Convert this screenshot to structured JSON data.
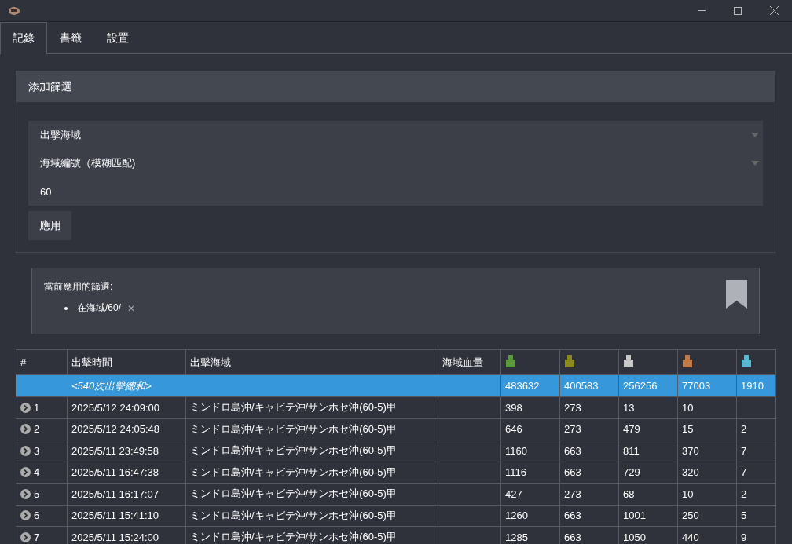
{
  "tabs": [
    {
      "label": "記錄",
      "selected": true
    },
    {
      "label": "書籤",
      "selected": false
    },
    {
      "label": "設置",
      "selected": false
    }
  ],
  "filter": {
    "title": "添加篩選",
    "fields": [
      {
        "kind": "select",
        "value": "出擊海域"
      },
      {
        "kind": "select",
        "value": "海域編號（模糊匹配)"
      },
      {
        "kind": "input",
        "value": "60"
      }
    ],
    "apply": "應用"
  },
  "applied": {
    "title": "當前應用的篩選:",
    "items": [
      "在海域/60/"
    ],
    "remove": "✕"
  },
  "table": {
    "columns": [
      {
        "kind": "text",
        "label": "#"
      },
      {
        "kind": "text",
        "label": "出擊時間"
      },
      {
        "kind": "text",
        "label": "出擊海域"
      },
      {
        "kind": "text",
        "label": "海域血量"
      },
      {
        "kind": "icon",
        "color": "#5a9a3a"
      },
      {
        "kind": "icon",
        "color": "#8a8a1e"
      },
      {
        "kind": "icon",
        "color": "#c8c8c8"
      },
      {
        "kind": "icon",
        "color": "#c07a48"
      },
      {
        "kind": "icon",
        "color": "#5ab8d0"
      }
    ],
    "summary": {
      "label": "<540次出擊總和>",
      "values": [
        "483632",
        "400583",
        "256256",
        "77003",
        "1910"
      ]
    },
    "rows": [
      {
        "cells": [
          "1",
          "2025/5/12 24:09:00",
          "ミンドロ島沖/キャビテ沖/サンホセ沖(60-5)甲",
          "",
          "398",
          "273",
          "13",
          "10",
          ""
        ]
      },
      {
        "cells": [
          "2",
          "2025/5/12 24:05:48",
          "ミンドロ島沖/キャビテ沖/サンホセ沖(60-5)甲",
          "",
          "646",
          "273",
          "479",
          "15",
          "2"
        ]
      },
      {
        "cells": [
          "3",
          "2025/5/11 23:49:58",
          "ミンドロ島沖/キャビテ沖/サンホセ沖(60-5)甲",
          "",
          "1160",
          "663",
          "811",
          "370",
          "7"
        ]
      },
      {
        "cells": [
          "4",
          "2025/5/11 16:47:38",
          "ミンドロ島沖/キャビテ沖/サンホセ沖(60-5)甲",
          "",
          "1116",
          "663",
          "729",
          "320",
          "7"
        ]
      },
      {
        "cells": [
          "5",
          "2025/5/11 16:17:07",
          "ミンドロ島沖/キャビテ沖/サンホセ沖(60-5)甲",
          "",
          "427",
          "273",
          "68",
          "10",
          "2"
        ]
      },
      {
        "cells": [
          "6",
          "2025/5/11 15:41:10",
          "ミンドロ島沖/キャビテ沖/サンホセ沖(60-5)甲",
          "",
          "1260",
          "663",
          "1001",
          "250",
          "5"
        ]
      },
      {
        "cells": [
          "7",
          "2025/5/11 15:24:00",
          "ミンドロ島沖/キャビテ沖/サンホセ沖(60-5)甲",
          "",
          "1285",
          "663",
          "1050",
          "440",
          "9"
        ]
      }
    ]
  }
}
